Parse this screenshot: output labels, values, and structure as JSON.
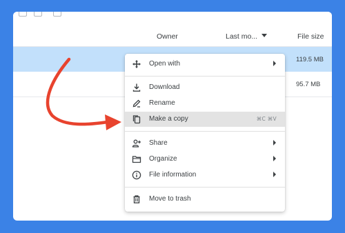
{
  "columns": {
    "owner": "Owner",
    "last_modified": "Last mo...",
    "file_size": "File size"
  },
  "rows": [
    {
      "size": "119.5 MB",
      "selected": true
    },
    {
      "size": "95.7 MB",
      "selected": false
    }
  ],
  "menu": {
    "open_with": "Open with",
    "download": "Download",
    "rename": "Rename",
    "make_copy": "Make a copy",
    "make_copy_shortcut": "⌘C ⌘V",
    "share": "Share",
    "organize": "Organize",
    "file_information": "File information",
    "move_to_trash": "Move to trash"
  },
  "colors": {
    "background": "#3b82e6",
    "selected_row": "#c2e0fb",
    "arrow": "#e8432e"
  }
}
